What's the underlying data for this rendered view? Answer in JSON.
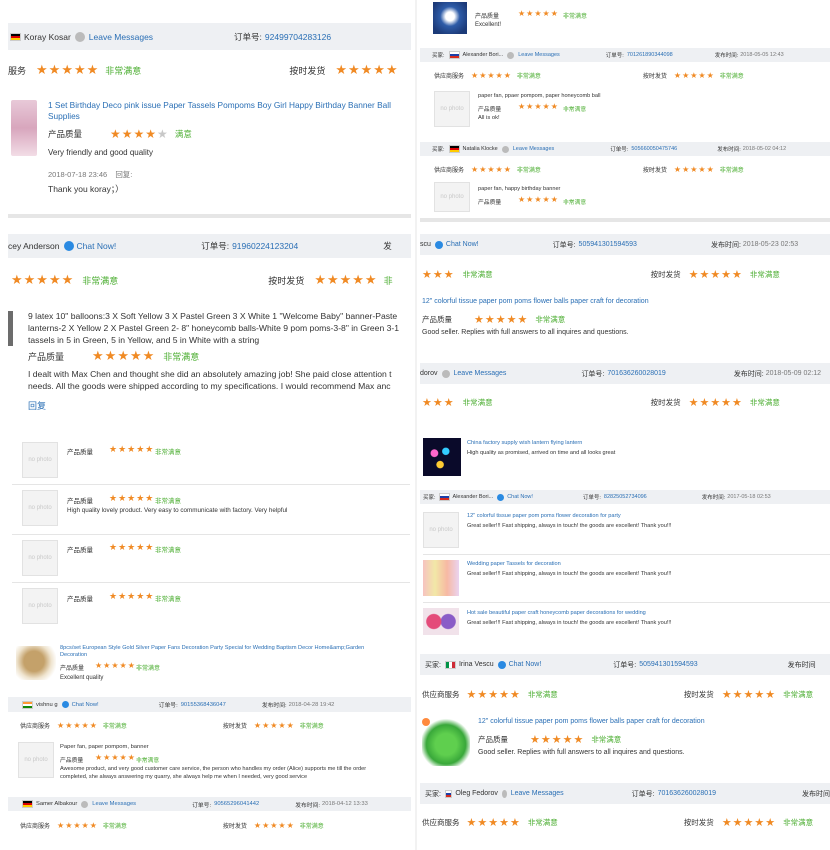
{
  "t1": {
    "buyer": "Koray Kosar",
    "leave": "Leave Messages",
    "order_label": "订单号:",
    "order_no": "92499704283126",
    "svc_label": "服务",
    "stars": "★★★★★",
    "very_satisfied": "非常满意",
    "ship_label": "按时发货",
    "product": "1 Set Birthday Deco pink issue Paper Tassels Pompoms Boy Girl Happy Birthday Banner Ball Supplies",
    "quality_label": "产品质量",
    "four_stars": "★★★★",
    "one_dim": "★",
    "satisfied": "满意",
    "comment": "Very friendly and good quality",
    "date": "2018-07-18 23:46",
    "reply_label": "回复:",
    "reply": "Thank you koray；）"
  },
  "t2": {
    "buyer": "cey Anderson",
    "chat": "Chat Now!",
    "order_label": "订单号:",
    "order_no": "91960224123204",
    "ship_label_cut": "发",
    "stars": "★★★★★",
    "very_satisfied": "非常满意",
    "ship_label": "按时发货",
    "vs_cut": "非",
    "desc1": "9 latex 10\" balloons:3 X Soft Yellow 3 X Pastel Green 3 X White 1 \"Welcome Baby\" banner-Paste",
    "desc2": "lanterns-2 X Yellow 2 X Pastel Green 2- 8\" honeycomb balls-White 9 pom poms-3-8\" in Green 3-1",
    "desc3": "tassels in 5 in Green, 5 in Yellow, and 5 in White with a string",
    "quality_label": "产品质量",
    "rev1": "I dealt with Max Chen and thought she did an absolutely amazing job! She paid close attention t",
    "rev2": "needs. All the goods were shipped according to my specifications. I would recommend Max anc",
    "reply": "回复"
  },
  "t3": {
    "quality_label": "产品质量",
    "stars": "★★★★★",
    "very_satisfied": "非常满意",
    "comment2": "High quality lovely product. Very easy to communicate with factory. Very helpful"
  },
  "t4": {
    "product": "8pcs/set European Style Gold Silver Paper Fans Decoration Party Special for Wedding Baptism Decor Home&amp;Garden Decoration",
    "quality_label": "产品质量",
    "stars": "★★★★★",
    "very_satisfied": "非常满意",
    "comment": "Excellent quality",
    "buyer": "vishnu g",
    "chat": "Chat Now!",
    "order_label": "订单号:",
    "order_no": "90155368436047",
    "date_label": "发布时间:",
    "date": "2018-04-28 19:42",
    "svc_label": "供应商服务",
    "ship_label": "按时发货",
    "product2": "Paper fan, paper pompom, banner",
    "rev1": "Awesome product, and very good customer care service, the person who handles my order (Alice) supports me till the order",
    "rev2": "completed, she always answering my quarry, she always help me when I needed, very good service",
    "buyer2": "Samer Albakour",
    "leave": "Leave Messages",
    "order_no2": "90565296041442",
    "date2": "2018-04-12 13:33"
  },
  "t5": {
    "quality_label": "产品质量",
    "stars": "★★★★★",
    "very_satisfied": "非常满意",
    "excellent": "Excellent!",
    "buyer": "Alexander Bori...",
    "leave": "Leave Messages",
    "order_label": "订单号:",
    "order_no": "701261890344098",
    "date_label": "发布时间:",
    "date": "2018-05-05 12:43",
    "svc_label": "供应商服务",
    "ship_label": "按时发货",
    "product": "paper fan, ppaer pompom, paper honeycomb ball",
    "allok": "All is ok!",
    "buyer2": "Natalia Klocke",
    "order_no2": "505660050475746",
    "date2": "2018-05-02 04:12",
    "product2": "paper fan, happy birthday banner"
  },
  "t6": {
    "buyer": "scu",
    "chat": "Chat Now!",
    "order_label": "订单号:",
    "order_no": "505941301594593",
    "date_label": "发布时间:",
    "date": "2018-05-23 02:53",
    "stars": "★★★",
    "stars5": "★★★★★",
    "very_satisfied": "非常满意",
    "ship_label": "按时发货",
    "product": "12\" colorful tissue paper pom poms flower balls paper craft for decoration",
    "quality_label": "产品质量",
    "comment": "Good seller. Replies with full answers to all inquires and questions.",
    "buyer2": "dorov",
    "leave": "Leave Messages",
    "order_no2": "701636260028019",
    "date2": "2018-05-09 02:12"
  },
  "t7": {
    "product": "China factory supply wish lantern flying lantern",
    "comment": "High quality as promised, arrived on time and all looks great",
    "buyer_label": "买家:",
    "buyer": "Alexander Bori...",
    "chat": "Chat Now!",
    "order_label": "订单号:",
    "order_no": "82825052734096",
    "date_label": "发布时间:",
    "date": "2017-05-18 02:53",
    "p1": "12\" colorful tissue paper pom poms flower decoration for party",
    "great": "Great seller!!! Fast shipping, always in touch! the goods are excellent! Thank you!!!",
    "p2": "Wedding paper Tassels for decoration",
    "p3": "Hot sale beautiful paper craft honeycomb paper decorations for wedding"
  },
  "t8": {
    "buyer_label": "买家:",
    "buyer": "Irina Vescu",
    "chat": "Chat Now!",
    "order_label": "订单号:",
    "order_no": "505941301594593",
    "date_label": "发布时间",
    "svc_label": "供应商服务",
    "stars": "★★★★★",
    "very_satisfied": "非常满意",
    "ship_label": "按时发货",
    "product": "12\" colorful tissue paper pom poms flower balls paper craft for decoration",
    "quality_label": "产品质量",
    "comment": "Good seller. Replies with full answers to all inquires and questions.",
    "buyer2": "Oleg Fedorov",
    "leave": "Leave Messages",
    "order_no2": "701636260028019",
    "date_label2": "发布时间"
  }
}
